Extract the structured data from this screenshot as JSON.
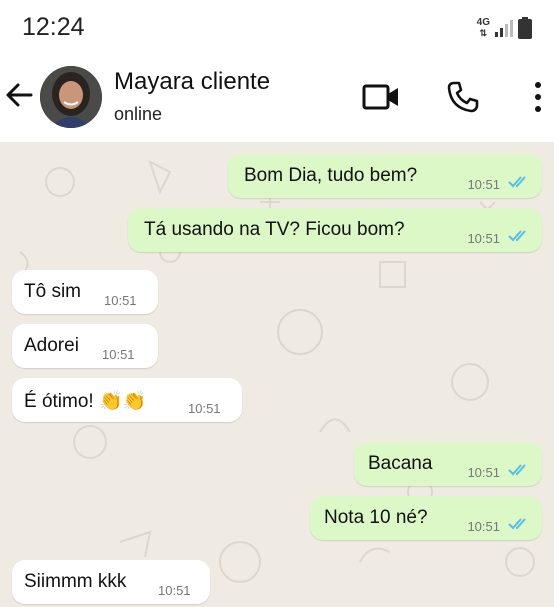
{
  "statusbar": {
    "time": "12:24",
    "network": "4G"
  },
  "contact": {
    "name": "Mayara cliente",
    "status": "online"
  },
  "icons": {
    "back": "arrow-left-icon",
    "video": "video-call-icon",
    "call": "phone-icon",
    "menu": "more-vertical-icon"
  },
  "colors": {
    "incoming_bubble": "#ffffff",
    "outgoing_bubble": "#dcf8c6",
    "read_ticks": "#53bdeb",
    "wallpaper": "#efeae2"
  },
  "messages": [
    {
      "direction": "out",
      "text": "Bom Dia, tudo bem?",
      "time": "10:51",
      "read": true
    },
    {
      "direction": "out",
      "text": "Tá usando na TV? Ficou bom?",
      "time": "10:51",
      "read": true
    },
    {
      "direction": "in",
      "text": "Tô sim",
      "time": "10:51"
    },
    {
      "direction": "in",
      "text": "Adorei",
      "time": "10:51"
    },
    {
      "direction": "in",
      "text": "É ótimo! 👏👏",
      "time": "10:51"
    },
    {
      "direction": "out",
      "text": "Bacana",
      "time": "10:51",
      "read": true
    },
    {
      "direction": "out",
      "text": "Nota 10 né?",
      "time": "10:51",
      "read": true
    },
    {
      "direction": "in",
      "text": "Siimmm kkk",
      "time": "10:51"
    }
  ]
}
